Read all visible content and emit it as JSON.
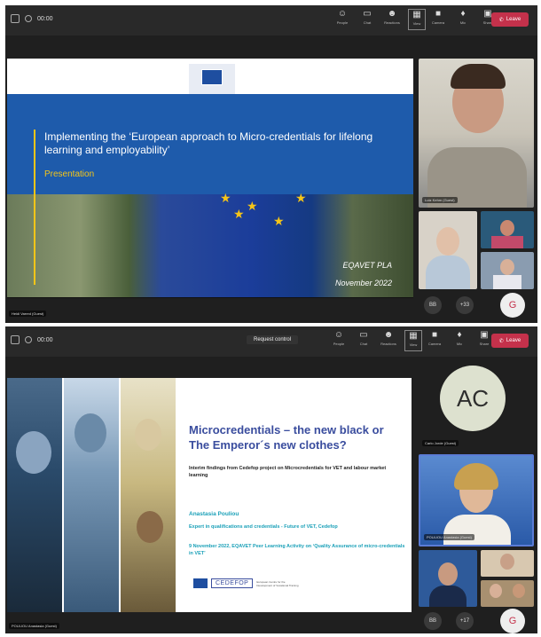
{
  "shot1": {
    "timer": "00:00",
    "controls": [
      {
        "icon": "people-icon",
        "label": "People"
      },
      {
        "icon": "chat-icon",
        "label": "Chat"
      },
      {
        "icon": "reactions-icon",
        "label": "Reactions"
      },
      {
        "icon": "view-icon",
        "label": "View"
      },
      {
        "icon": "camera-icon",
        "label": "Camera"
      },
      {
        "icon": "mic-icon",
        "label": "Mic"
      },
      {
        "icon": "share-icon",
        "label": "Share"
      }
    ],
    "leave_label": "Leave",
    "slide": {
      "title": "Implementing the ‘European approach to Micro-credentials for lifelong learning and employability’",
      "subtitle": "Presentation",
      "event": "EQAVET PLA",
      "date": "November 2022"
    },
    "presenter_label": "Heidi Varred (Guest)",
    "main_video_label": "Lutz Kehm (Guest)",
    "avatar_initial": "G",
    "more_label": "+33",
    "you_label": "BB"
  },
  "shot2": {
    "timer": "00:00",
    "request_control": "Request control",
    "controls": [
      {
        "icon": "people-icon",
        "label": "People"
      },
      {
        "icon": "chat-icon",
        "label": "Chat"
      },
      {
        "icon": "reactions-icon",
        "label": "Reactions"
      },
      {
        "icon": "view-icon",
        "label": "View"
      },
      {
        "icon": "camera-icon",
        "label": "Camera"
      },
      {
        "icon": "mic-icon",
        "label": "Mic"
      },
      {
        "icon": "share-icon",
        "label": "Share"
      }
    ],
    "leave_label": "Leave",
    "slide": {
      "title": "Microcredentials – the new black or The Emperor´s new clothes?",
      "interim": "Interim findings from Cedefop project on Microcredentials for VET and labour market learning",
      "speaker_name": "Anastasia Pouliou",
      "speaker_role": "Expert in qualifications and credentials - Future of VET, Cedefop",
      "event_line": "9 November 2022, EQAVET Peer Learning Activity on ‘Quality Assurance of micro-credentials in VET’",
      "logo_text": "CEDEFOP",
      "logo_tagline": "European Centre for the Development of Vocational Training"
    },
    "presenter_label": "POULIOU Anastasia (Guest)",
    "ac_initials": "AC",
    "ac_label": "Carlo Jorde (Guest)",
    "speaker_video_label": "POULIOU Anastasia (Guest)",
    "avatar_initial": "G",
    "more_label": "+17",
    "you_label": "BB"
  },
  "colors": {
    "leave_red": "#c4314b",
    "eu_blue": "#1e5bab",
    "eu_yellow": "#f5c518",
    "cedefop_blue": "#3a4d9e",
    "accent_teal": "#1aa0b8"
  }
}
